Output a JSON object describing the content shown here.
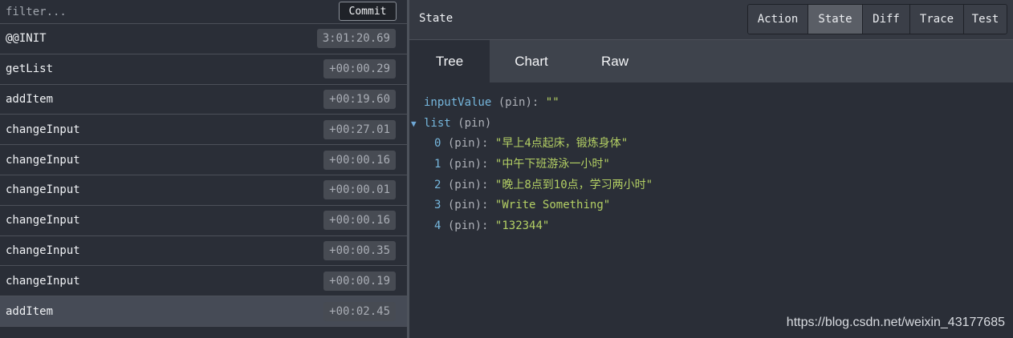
{
  "filter": {
    "placeholder": "filter...",
    "commit_label": "Commit"
  },
  "actions": [
    {
      "name": "@@INIT",
      "time": "3:01:20.69"
    },
    {
      "name": "getList",
      "time": "+00:00.29"
    },
    {
      "name": "addItem",
      "time": "+00:19.60"
    },
    {
      "name": "changeInput",
      "time": "+00:27.01"
    },
    {
      "name": "changeInput",
      "time": "+00:00.16"
    },
    {
      "name": "changeInput",
      "time": "+00:00.01"
    },
    {
      "name": "changeInput",
      "time": "+00:00.16"
    },
    {
      "name": "changeInput",
      "time": "+00:00.35"
    },
    {
      "name": "changeInput",
      "time": "+00:00.19"
    },
    {
      "name": "addItem",
      "time": "+00:02.45"
    }
  ],
  "state_panel": {
    "title": "State",
    "mode_buttons": [
      "Action",
      "State",
      "Diff",
      "Trace",
      "Test"
    ],
    "active_mode": "State",
    "tabs": [
      "Tree",
      "Chart",
      "Raw"
    ],
    "active_tab": "Tree"
  },
  "tree": {
    "pin_label": "(pin)",
    "input_value": {
      "key": "inputValue",
      "value": "\"\""
    },
    "list": {
      "key": "list",
      "toggle_icon": "expanded-triangle-icon",
      "items": [
        {
          "index": "0",
          "value": "\"早上4点起床，锻炼身体\""
        },
        {
          "index": "1",
          "value": "\"中午下班游泳一小时\""
        },
        {
          "index": "2",
          "value": "\"晚上8点到10点，学习两小时\""
        },
        {
          "index": "3",
          "value": "\"Write Something\""
        },
        {
          "index": "4",
          "value": "\"132344\""
        }
      ]
    }
  },
  "watermark": "https://blog.csdn.net/weixin_43177685"
}
